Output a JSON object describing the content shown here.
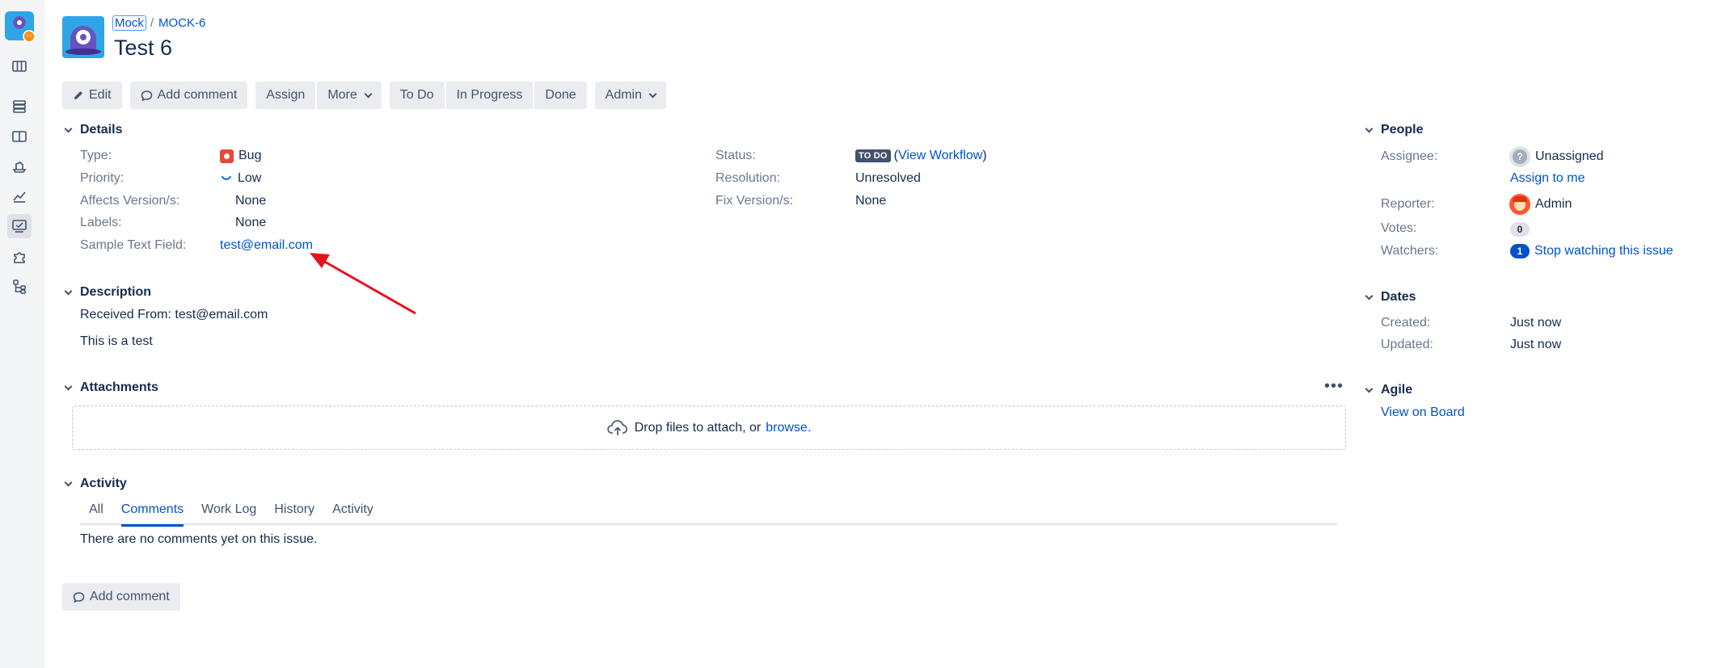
{
  "sidebar": {
    "badge_symbol": "‹›",
    "icons": [
      "board-icon",
      "backlog-icon",
      "columns-icon",
      "releases-icon",
      "reports-icon",
      "issues-icon",
      "add-ons-icon",
      "components-icon"
    ]
  },
  "breadcrumb": {
    "project": "Mock",
    "separator": "/",
    "issue_key": "MOCK-6"
  },
  "issue": {
    "title": "Test 6"
  },
  "toolbar": {
    "edit": "Edit",
    "add_comment": "Add comment",
    "assign": "Assign",
    "more": "More",
    "to_do": "To Do",
    "in_progress": "In Progress",
    "done": "Done",
    "admin": "Admin"
  },
  "details": {
    "heading": "Details",
    "type_label": "Type:",
    "type_value": "Bug",
    "priority_label": "Priority:",
    "priority_value": "Low",
    "affects_label": "Affects Version/s:",
    "affects_value": "None",
    "labels_label": "Labels:",
    "labels_value": "None",
    "sample_label": "Sample Text Field:",
    "sample_value": "test@email.com",
    "status_label": "Status:",
    "status_value": "TO DO",
    "view_workflow_open": "(",
    "view_workflow": "View Workflow",
    "view_workflow_close": ")",
    "resolution_label": "Resolution:",
    "resolution_value": "Unresolved",
    "fix_label": "Fix Version/s:",
    "fix_value": "None"
  },
  "description": {
    "heading": "Description",
    "line1": "Received From: test@email.com",
    "line2": "This is a test"
  },
  "attachments": {
    "heading": "Attachments",
    "drop_text": "Drop files to attach, or",
    "browse": "browse.",
    "more_dots": "•••"
  },
  "activity": {
    "heading": "Activity",
    "tabs": [
      "All",
      "Comments",
      "Work Log",
      "History",
      "Activity"
    ],
    "active_tab": "Comments",
    "empty": "There are no comments yet on this issue.",
    "add_comment": "Add comment"
  },
  "people": {
    "heading": "People",
    "assignee_label": "Assignee:",
    "assignee_value": "Unassigned",
    "assignee_avatar_glyph": "?",
    "assign_to_me": "Assign to me",
    "reporter_label": "Reporter:",
    "reporter_value": "Admin",
    "votes_label": "Votes:",
    "votes_count": "0",
    "watchers_label": "Watchers:",
    "watchers_count": "1",
    "stop_watching": "Stop watching this issue"
  },
  "dates": {
    "heading": "Dates",
    "created_label": "Created:",
    "created_value": "Just now",
    "updated_label": "Updated:",
    "updated_value": "Just now"
  },
  "agile": {
    "heading": "Agile",
    "view_on_board": "View on Board"
  },
  "colors": {
    "link": "#0052cc",
    "annotation_arrow": "#e8121c",
    "bug": "#e5493a",
    "lozenge": "#42526e"
  }
}
